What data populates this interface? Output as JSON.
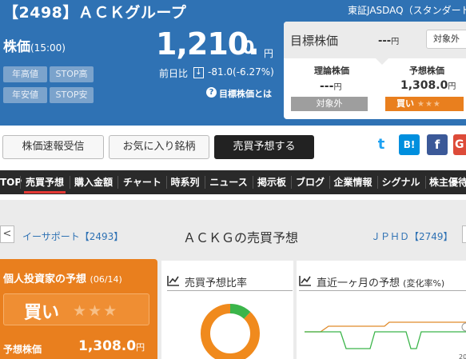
{
  "header": {
    "title": "【2498】ＡＣＫグループ",
    "market": "東証JASDAQ（スタンダード",
    "price_label": "株価",
    "price_time": "(15:00)",
    "price_main": "1,210.",
    "price_decimal": "0",
    "price_unit": "円",
    "change_label": "前日比",
    "change_arrow": "↓",
    "change_value": "-81.0(-6.27%)",
    "target_link": "目標株価とは",
    "buttons": [
      "年高値",
      "STOP高",
      "年安値",
      "STOP安"
    ]
  },
  "target_card": {
    "title": "目標株価",
    "value": "---",
    "value_unit": "円",
    "badge": "対象外",
    "theory_label": "理論株価",
    "theory_value": "---",
    "theory_unit": "円",
    "theory_status": "対象外",
    "forecast_label": "予想株価",
    "forecast_value": "1,308.0",
    "forecast_unit": "円",
    "forecast_status": "買い",
    "forecast_stars": "★★★"
  },
  "actions": {
    "realtime": "株価速報受信",
    "favorite": "お気に入り銘柄",
    "forecast": "売買予想する",
    "social": {
      "twitter": "t",
      "hatena": "B!",
      "facebook": "f",
      "google": "G"
    }
  },
  "nav": [
    "TOP",
    "売買予想",
    "購入金額",
    "チャート",
    "時系列",
    "ニュース",
    "掲示板",
    "ブログ",
    "企業情報",
    "シグナル",
    "株主優待"
  ],
  "pager": {
    "prev_arrow": "<",
    "prev_link": "イーサポート【2493】",
    "title": "ＡＣＫＧの売買予想",
    "next_link": "ＪＰＨＤ【2749】"
  },
  "investor_panel": {
    "title": "個人投資家の予想",
    "date": "(06/14)",
    "verdict": "買い",
    "stars": "★★★",
    "price_label": "予想株価",
    "price": "1,308.0",
    "price_unit": "円"
  },
  "ratio_panel": {
    "title": "売買予想比率",
    "buy_ratio": 0.88,
    "sell_ratio": 0.12,
    "buy_color": "#f08a1d",
    "sell_color": "#3bb54a"
  },
  "month_panel": {
    "title": "直近一ヶ月の予想",
    "subtitle": "(変化率%)",
    "axis_fragment": "20"
  },
  "colors": {
    "header_blue": "#2f72b4",
    "accent_orange": "#e97f1e",
    "nav_dark": "#2a2a2a",
    "active_red": "#e53935"
  }
}
